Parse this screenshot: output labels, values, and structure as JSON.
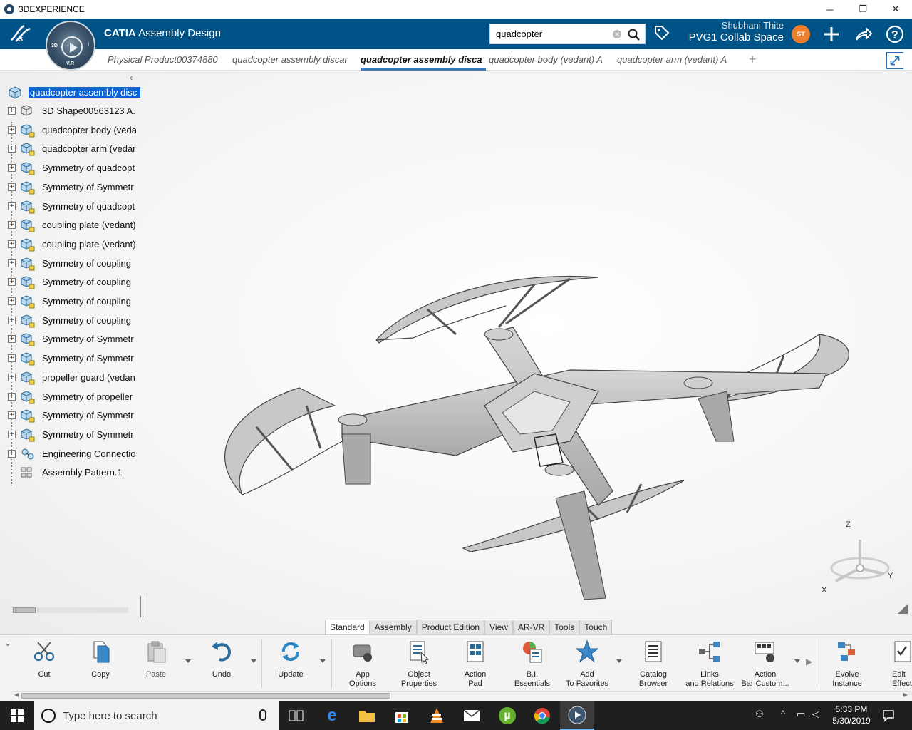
{
  "window": {
    "title": "3DEXPERIENCE",
    "minimize": "─",
    "maximize": "❐",
    "close": "✕"
  },
  "header": {
    "brand_logo": "3DS",
    "compass_labels": [
      "3D",
      "i",
      "V.R"
    ],
    "app_name": "CATIA",
    "app_module": "Assembly Design",
    "search_value": "quadcopter",
    "search_placeholder": "Search",
    "user_name": "Shubhani Thite",
    "collab_space": "PVG1 Collab Space",
    "avatar_initials": "ST",
    "accent": "#005386"
  },
  "tabs": [
    {
      "label": "Physical Product00374880",
      "active": false
    },
    {
      "label": "quadcopter assembly discar",
      "active": false
    },
    {
      "label": "quadcopter assembly disca",
      "active": true
    },
    {
      "label": "quadcopter body (vedant) A",
      "active": false
    },
    {
      "label": "quadcopter arm (vedant) A",
      "active": false
    }
  ],
  "tab_add": "+",
  "tree": {
    "collapse_glyph": "‹",
    "root": "quadcopter assembly disc",
    "nodes": [
      {
        "label": "3D Shape00563123 A.",
        "icon": "shape-icon"
      },
      {
        "label": "quadcopter body (veda",
        "icon": "product-icon"
      },
      {
        "label": "quadcopter arm (vedar",
        "icon": "product-icon"
      },
      {
        "label": "Symmetry of quadcopt",
        "icon": "product-icon"
      },
      {
        "label": "Symmetry of Symmetr",
        "icon": "product-icon"
      },
      {
        "label": "Symmetry of quadcopt",
        "icon": "product-icon"
      },
      {
        "label": "coupling plate (vedant)",
        "icon": "product-icon"
      },
      {
        "label": "coupling plate (vedant)",
        "icon": "product-icon"
      },
      {
        "label": "Symmetry of coupling",
        "icon": "product-icon"
      },
      {
        "label": "Symmetry of coupling",
        "icon": "product-icon"
      },
      {
        "label": "Symmetry of coupling",
        "icon": "product-icon"
      },
      {
        "label": "Symmetry of coupling",
        "icon": "product-icon"
      },
      {
        "label": "Symmetry of Symmetr",
        "icon": "product-icon"
      },
      {
        "label": "Symmetry of Symmetr",
        "icon": "product-icon"
      },
      {
        "label": "propeller guard (vedan",
        "icon": "product-icon"
      },
      {
        "label": "Symmetry of propeller",
        "icon": "product-icon"
      },
      {
        "label": "Symmetry of Symmetr",
        "icon": "product-icon"
      },
      {
        "label": "Symmetry of Symmetr",
        "icon": "product-icon"
      },
      {
        "label": "Engineering Connectio",
        "icon": "connection-icon"
      },
      {
        "label": "Assembly Pattern.1",
        "icon": "pattern-icon"
      }
    ]
  },
  "triad": {
    "z": "Z",
    "x": "X",
    "y": "Y"
  },
  "action_tabs": [
    "Standard",
    "Assembly",
    "Product Edition",
    "View",
    "AR-VR",
    "Tools",
    "Touch"
  ],
  "action_tab_active": "Standard",
  "actions": {
    "cut": "Cut",
    "copy": "Copy",
    "paste": "Paste",
    "undo": "Undo",
    "update": "Update",
    "app_options_1": "App",
    "app_options_2": "Options",
    "object_properties_1": "Object",
    "object_properties_2": "Properties",
    "action_pad_1": "Action",
    "action_pad_2": "Pad",
    "bi_essentials_1": "B.I.",
    "bi_essentials_2": "Essentials",
    "add_favorites_1": "Add",
    "add_favorites_2": "To Favorites",
    "catalog_browser_1": "Catalog",
    "catalog_browser_2": "Browser",
    "links_relations_1": "Links",
    "links_relations_2": "and Relations",
    "action_bar_custom_1": "Action",
    "action_bar_custom_2": "Bar Custom...",
    "evolve_instance_1": "Evolve",
    "evolve_instance_2": "Instance",
    "edit_effectivity_1": "Edit",
    "edit_effectivity_2": "Effectivity"
  },
  "taskbar": {
    "search_placeholder": "Type here to search",
    "time": "5:33 PM",
    "date": "5/30/2019"
  }
}
